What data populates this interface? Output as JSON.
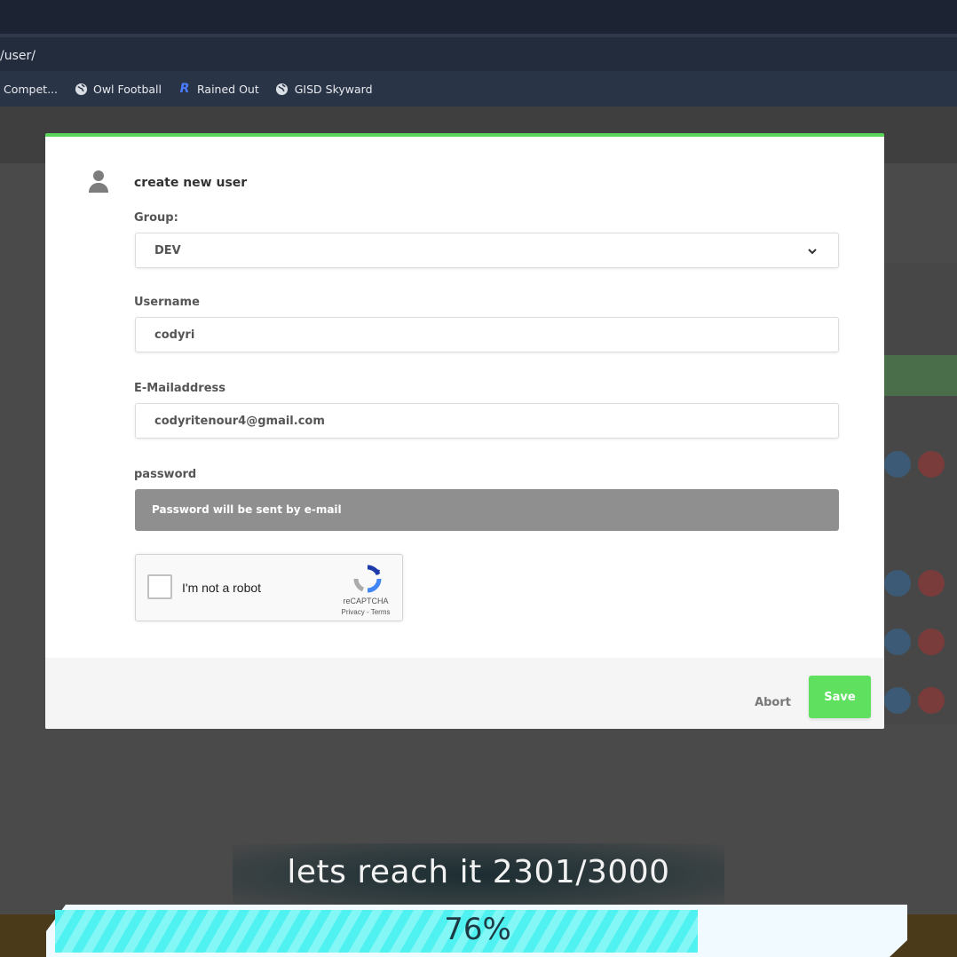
{
  "browser": {
    "address": "/user/",
    "bookmarks": [
      {
        "label": "Compet...",
        "icon": "tab-page-icon"
      },
      {
        "label": "Owl Football",
        "icon": "globe-icon"
      },
      {
        "label": "Rained Out",
        "icon": "r-logo-icon"
      },
      {
        "label": "GISD Skyward",
        "icon": "globe-icon"
      }
    ]
  },
  "modal": {
    "title": "create new user",
    "group": {
      "label": "Group:",
      "value": "DEV"
    },
    "username": {
      "label": "Username",
      "value": "codyri"
    },
    "email": {
      "label": "E-Mailaddress",
      "value": "codyritenour4@gmail.com"
    },
    "password": {
      "label": "password",
      "notice": "Password will be sent by e-mail"
    },
    "captcha": {
      "label": "I'm not a robot",
      "brand": "reCAPTCHA",
      "links": "Privacy - Terms"
    },
    "abort_label": "Abort",
    "save_label": "Save",
    "accent_color": "#5ad55a"
  },
  "overlay": {
    "goal_text": "lets reach it  2301/3000",
    "progress_percent": 76,
    "progress_label": "76%",
    "fill_color": "#4ff2f0"
  }
}
